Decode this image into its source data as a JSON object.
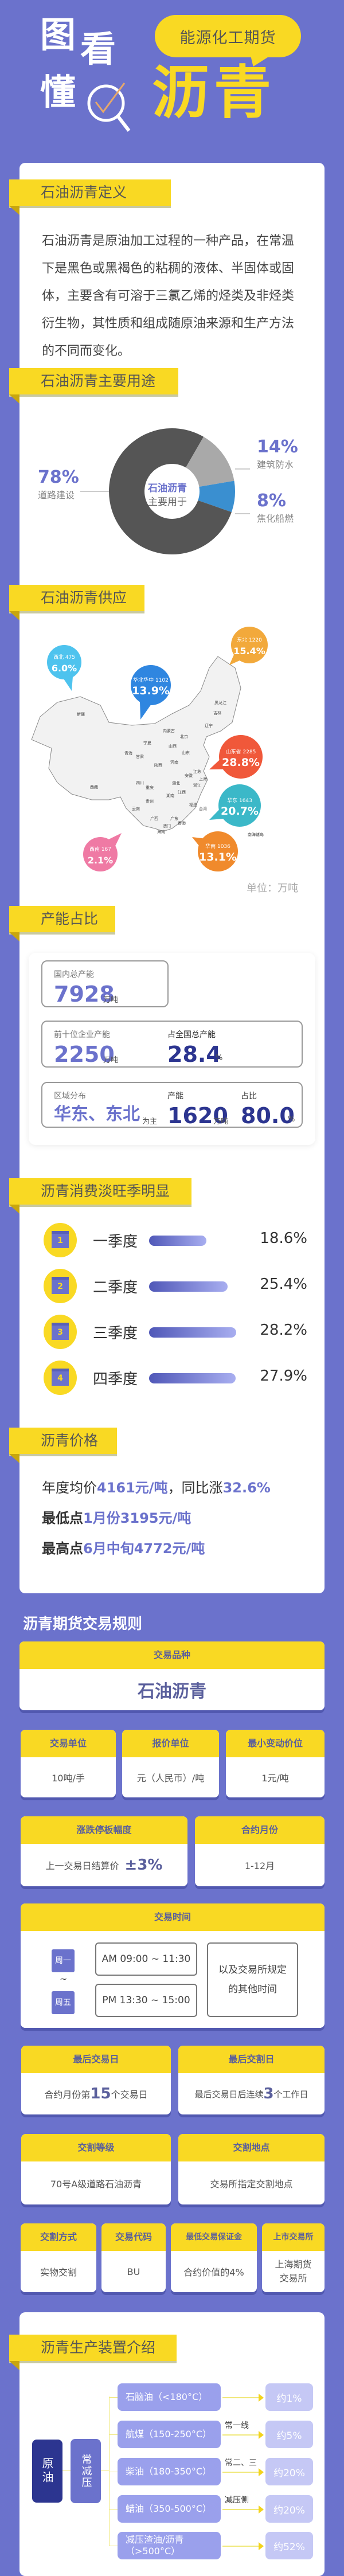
{
  "header": {
    "logo_chars": [
      "图",
      "看",
      "懂"
    ],
    "bubble": "能源化工期货",
    "title": "沥青"
  },
  "definition": {
    "heading": "石油沥青定义",
    "text": "石油沥青是原油加工过程的一种产品，在常温下是黑色或黑褐色的粘稠的液体、半固体或固体，主要含有可溶于三氯乙烯的烃类及非烃类衍生物，其性质和组成随原油来源和生产方法的不同而变化。"
  },
  "uses": {
    "heading": "石油沥青主要用途",
    "center": [
      "石油沥青",
      "主要用于"
    ],
    "chart_data": {
      "type": "pie",
      "categories": [
        "道路建设",
        "建筑防水",
        "焦化船燃"
      ],
      "values": [
        78,
        14,
        8
      ],
      "labels": [
        "78%",
        "14%",
        "8%"
      ],
      "colors": [
        "#555555",
        "#a9a9a9",
        "#3a8fd0"
      ]
    }
  },
  "supply": {
    "heading": "石油沥青供应",
    "unit": "单位：万吨",
    "regions": [
      {
        "name": "西北",
        "value": "475",
        "pct": "6.0%",
        "color": "#4ec3ee"
      },
      {
        "name": "华北华中",
        "value": "1102",
        "pct": "13.9%",
        "color": "#2f86e0"
      },
      {
        "name": "东北",
        "value": "1220",
        "pct": "15.4%",
        "color": "#f2a93b"
      },
      {
        "name": "山东省",
        "value": "2285",
        "pct": "28.8%",
        "color": "#f0583a"
      },
      {
        "name": "华东",
        "value": "1643",
        "pct": "20.7%",
        "color": "#3bb8c8"
      },
      {
        "name": "华南",
        "value": "1036",
        "pct": "13.1%",
        "color": "#f08a2c"
      },
      {
        "name": "西南",
        "value": "167",
        "pct": "2.1%",
        "color": "#ef7aa4"
      }
    ],
    "provinces": [
      "新疆",
      "西藏",
      "青海",
      "甘肃",
      "宁夏",
      "内蒙古",
      "北京",
      "山西",
      "山东",
      "河南",
      "陕西",
      "四川",
      "重庆",
      "湖北",
      "安徽",
      "江苏",
      "上海",
      "浙江",
      "湖南",
      "江西",
      "贵州",
      "云南",
      "广西",
      "广东",
      "福建",
      "台湾",
      "澳门",
      "香港",
      "海南",
      "黑龙江",
      "吉林",
      "辽宁",
      "南海诸岛"
    ]
  },
  "capacity": {
    "heading": "产能占比",
    "total_label": "国内总产能",
    "total_value": "7928",
    "total_unit": "万吨",
    "top10_label": "前十位企业产能",
    "top10_value": "2250",
    "top10_unit": "万吨",
    "share_label": "占全国总产能",
    "share_value": "28.4",
    "share_unit": "%",
    "region_label": "区域分布",
    "region_value": "华东、东北",
    "region_suffix": "为主",
    "region_cap_label": "产能",
    "region_cap_value": "1620",
    "region_cap_unit": "万吨",
    "region_share_label": "占比",
    "region_share_value": "80.0",
    "region_share_unit": "%"
  },
  "seasonal": {
    "heading": "沥青消费淡旺季明显",
    "chart_data": {
      "type": "bar",
      "categories": [
        "一季度",
        "二季度",
        "三季度",
        "四季度"
      ],
      "values": [
        18.6,
        25.4,
        28.2,
        27.9
      ],
      "labels": [
        "18.6%",
        "25.4%",
        "28.2%",
        "27.9%"
      ],
      "icons": [
        "1",
        "2",
        "3",
        "4"
      ]
    }
  },
  "price": {
    "heading": "沥青价格",
    "line1_a": "年度均价",
    "line1_b": "4161元/吨",
    "line1_c": "，同比涨",
    "line1_d": "32.6%",
    "line2_a": "最低点",
    "line2_b": "1月份3195元/吨",
    "line3_a": "最高点",
    "line3_b": "6月中旬4772元/吨"
  },
  "rules": {
    "title": "沥青期货交易规则",
    "variety": {
      "h": "交易品种",
      "v": "石油沥青"
    },
    "unit": {
      "h": "交易单位",
      "v": "10吨/手"
    },
    "quote": {
      "h": "报价单位",
      "v": "元（人民币）/吨"
    },
    "tick": {
      "h": "最小变动价位",
      "v": "1元/吨"
    },
    "limit": {
      "h": "涨跌停板幅度",
      "v": "上一交易日结算价",
      "v2": "±3%"
    },
    "months": {
      "h": "合约月份",
      "v": "1-12月"
    },
    "hours": {
      "h": "交易时间",
      "day_from": "周一",
      "tilde": "~",
      "day_to": "周五",
      "am": "AM 09:00 ~ 11:30",
      "pm": "PM 13:30 ~ 15:00",
      "other": "以及交易所规定的其他时间"
    },
    "last_trade": {
      "h": "最后交易日",
      "a": "合约月份第",
      "n": "15",
      "b": "个交易日"
    },
    "last_delivery": {
      "h": "最后交割日",
      "a": "最后交易日后连续",
      "n": "3",
      "b": "个工作日"
    },
    "grade": {
      "h": "交割等级",
      "v": "70号A级道路石油沥青"
    },
    "place": {
      "h": "交割地点",
      "v": "交易所指定交割地点"
    },
    "method": {
      "h": "交割方式",
      "v": "实物交割"
    },
    "code": {
      "h": "交易代码",
      "v": "BU"
    },
    "margin": {
      "h": "最低交易保证金",
      "v": "合约价值的4%"
    },
    "exchange": {
      "h": "上市交易所",
      "v": "上海期货",
      "v2": "交易所"
    }
  },
  "production": {
    "heading": "沥青生产装置介绍",
    "crude": "原油",
    "unit": "常减压",
    "products": [
      {
        "name": "石脑油（<180°C）",
        "tag": "",
        "pct": "约1%"
      },
      {
        "name": "航煤（150-250°C）",
        "tag": "常一线",
        "pct": "约5%"
      },
      {
        "name": "柴油（180-350°C）",
        "tag": "常二、三",
        "pct": "约20%"
      },
      {
        "name": "蜡油（350-500°C）",
        "tag": "减压侧",
        "pct": "约20%"
      },
      {
        "name": "减压渣油/沥青（>500°C）",
        "tag": "",
        "pct": "约52%"
      }
    ]
  }
}
